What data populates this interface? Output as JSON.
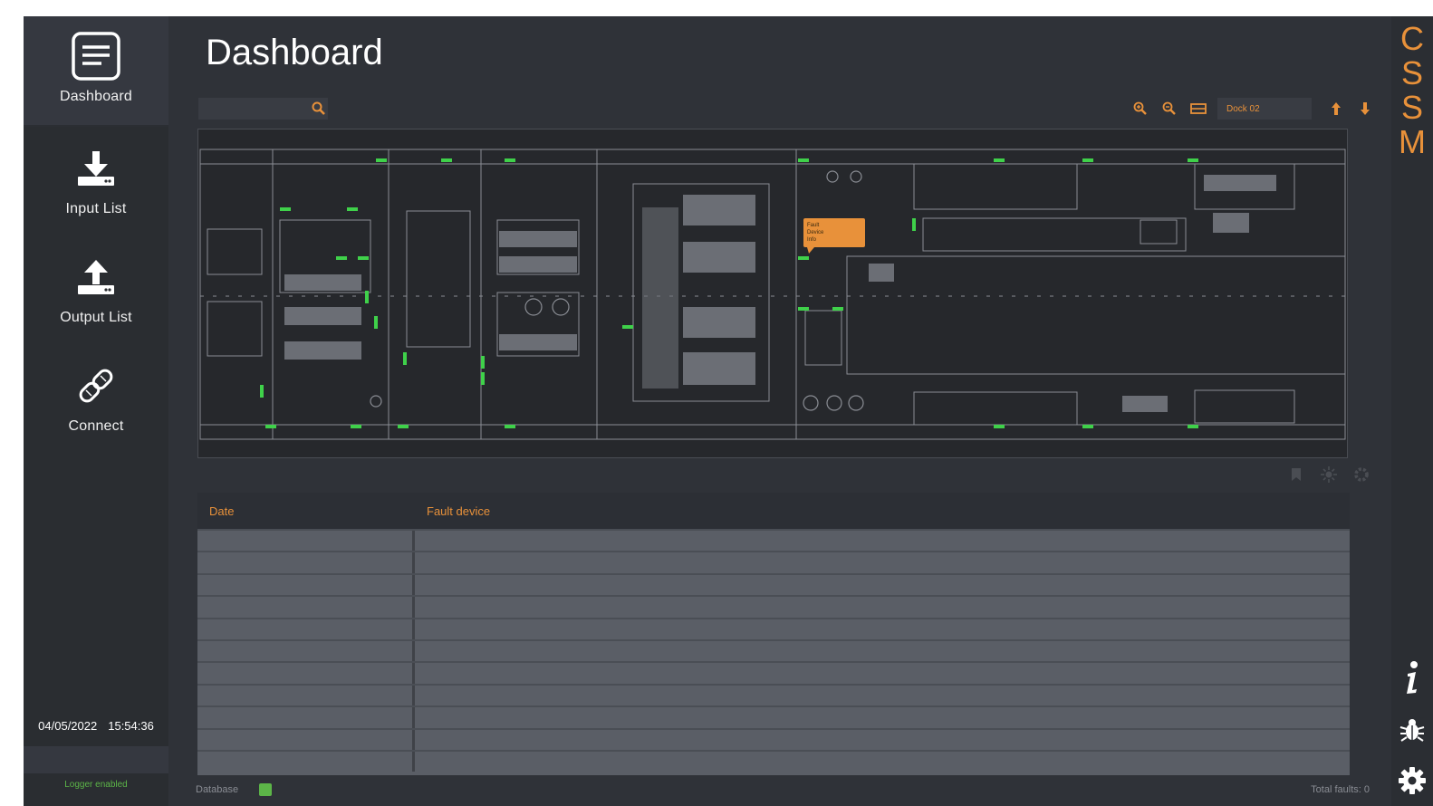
{
  "app": {
    "logo_letters": [
      "C",
      "S",
      "S",
      "M"
    ]
  },
  "nav": {
    "items": [
      {
        "label": "Dashboard",
        "icon": "dashboard-icon",
        "active": true
      },
      {
        "label": "Input List",
        "icon": "download-icon",
        "active": false
      },
      {
        "label": "Output List",
        "icon": "upload-icon",
        "active": false
      },
      {
        "label": "Connect",
        "icon": "link-icon",
        "active": false
      }
    ],
    "date": "04/05/2022",
    "time": "15:54:36",
    "logger_status": "Logger enabled"
  },
  "header": {
    "title": "Dashboard"
  },
  "search": {
    "value": "",
    "placeholder": ""
  },
  "toolbar": {
    "dock_select": "Dock 02"
  },
  "map": {
    "popup_lines": [
      "Fault",
      "Device",
      "Info"
    ]
  },
  "table": {
    "columns": [
      "Date",
      "Fault device"
    ],
    "rows": 11
  },
  "footer": {
    "database_label": "Database",
    "database_status_color": "#5cb548",
    "total_faults": "Total faults: 0"
  },
  "colors": {
    "accent": "#e8913a",
    "background": "#2f3238",
    "panel": "#2b2e33",
    "table_row": "#5a5e66",
    "status_green": "#5cb548"
  }
}
